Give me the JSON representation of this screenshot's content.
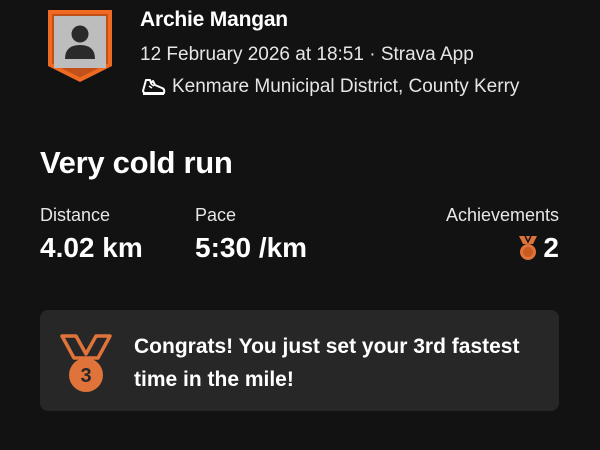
{
  "header": {
    "author_name": "Archie Mangan",
    "meta": "12 February 2026 at 18:51 · Strava App",
    "location": "Kenmare Municipal District, County Kerry",
    "avatar_icon": "user-silhouette-icon",
    "shoe_icon": "running-shoe-icon"
  },
  "activity": {
    "title": "Very cold run"
  },
  "stats": {
    "distance": {
      "label": "Distance",
      "value": "4.02 km"
    },
    "pace": {
      "label": "Pace",
      "value": "5:30 /km"
    },
    "achievements": {
      "label": "Achievements",
      "value": "2",
      "icon": "medal-icon"
    }
  },
  "achievement_card": {
    "icon": "bronze-medal-icon",
    "medal_number": "3",
    "text": "Congrats! You just set your 3rd fastest time in the mile!"
  },
  "colors": {
    "background": "#121212",
    "card": "#272727",
    "accent_orange": "#e0733a",
    "badge_orange": "#f06a22",
    "text": "#ffffff"
  }
}
